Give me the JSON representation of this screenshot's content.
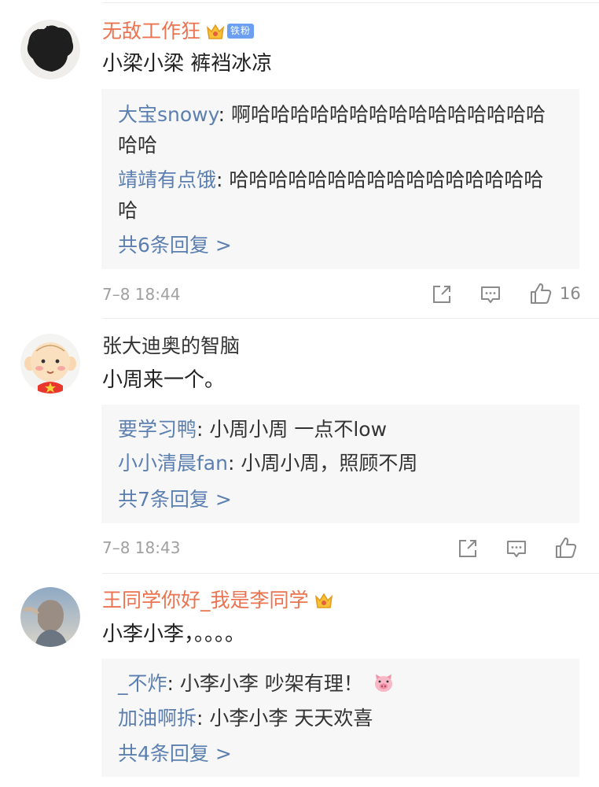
{
  "comments": [
    {
      "username": "无敌工作狂",
      "badge_label": "铁粉",
      "text": "小梁小梁 裤裆冰凉",
      "replies": [
        {
          "name": "大宝snowy",
          "sep": ": ",
          "text": "啊哈哈哈哈哈哈哈哈哈哈哈哈哈哈哈哈哈"
        },
        {
          "name": "靖靖有点饿",
          "sep": ": ",
          "text": "哈哈哈哈哈哈哈哈哈哈哈哈哈哈哈哈哈"
        }
      ],
      "more_replies": "共6条回复 >",
      "time": "7–8 18:44",
      "like_count": "16"
    },
    {
      "username": "张大迪奥的智脑",
      "text": "小周来一个。",
      "replies": [
        {
          "name": "要学习鸭",
          "sep": ": ",
          "text": "小周小周 一点不low"
        },
        {
          "name": "小小清晨fan",
          "sep": ": ",
          "text": "小周小周，照顾不周"
        }
      ],
      "more_replies": "共7条回复 >",
      "time": "7–8 18:43"
    },
    {
      "username": "王同学你好_我是李同学",
      "text": "小李小李，。。。。",
      "replies": [
        {
          "name": "_不炸",
          "sep": ": ",
          "text": "小李小李 吵架有理！"
        },
        {
          "name": "加油啊拆",
          "sep": ": ",
          "text": "小李小李 天天欢喜"
        }
      ],
      "more_replies": "共4条回复 >"
    }
  ],
  "colors": {
    "vip_name": "#eb7350",
    "reply_name": "#5b7fb0",
    "reply_bg": "#f7f7f7",
    "meta_gray": "#a0a0a0"
  },
  "icons": [
    "share-icon",
    "comment-icon",
    "like-icon",
    "crown-icon",
    "pig-emoji-icon"
  ]
}
